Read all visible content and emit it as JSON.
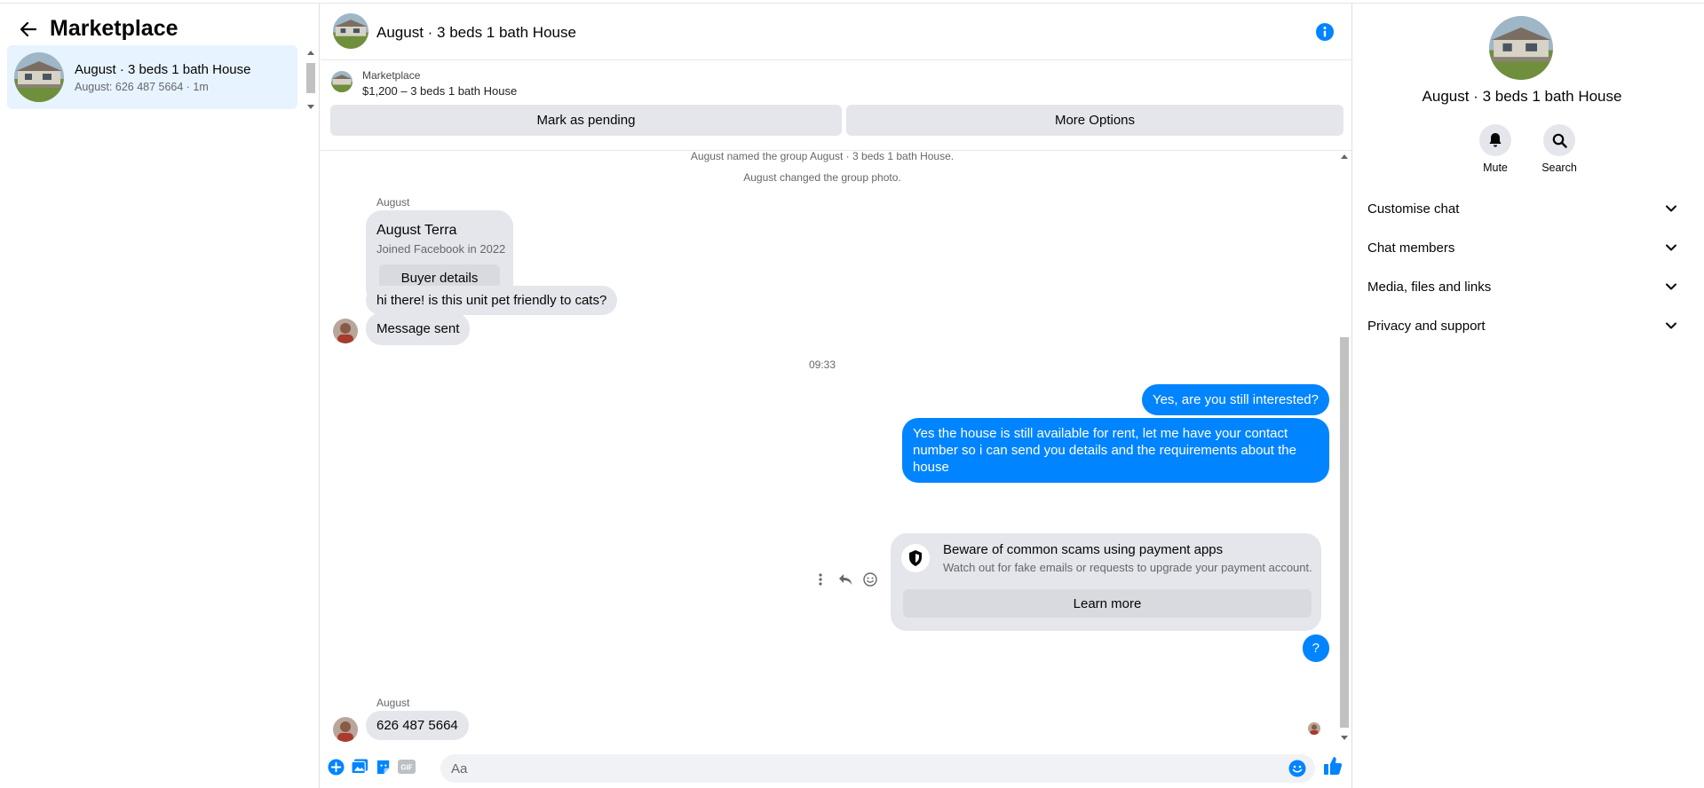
{
  "colors": {
    "accent": "#0084ff",
    "bubble_in": "#e4e6eb",
    "selected": "#e7f3ff"
  },
  "sidebar": {
    "title": "Marketplace",
    "conversations": [
      {
        "title": "August · 3 beds 1 bath House",
        "subtitle": "August: 626 487 5664 · 1m"
      }
    ]
  },
  "chat": {
    "title": "August · 3 beds 1 bath House",
    "listing": {
      "label": "Marketplace",
      "price_title": "$1,200 – 3 beds 1 bath House",
      "mark_pending": "Mark as pending",
      "more_options": "More Options"
    },
    "system_messages": [
      "August named the group August · 3 beds 1 bath House.",
      "August changed the group photo."
    ],
    "buyer_card": {
      "sender": "August",
      "name": "August Terra",
      "subtitle": "Joined Facebook in 2022",
      "button": "Buyer details"
    },
    "incoming_1": "hi there! is this unit pet friendly to cats?",
    "incoming_2": "Message sent",
    "timestamp": "09:33",
    "outgoing_1": "Yes, are you still interested?",
    "outgoing_2": "Yes the house is still available for rent, let me have your contact number so i can send you details and the requirements about the house",
    "scam_warning": {
      "title": "Beware of common scams using payment apps",
      "subtitle": "Watch out for fake emails or requests to upgrade your payment account.",
      "button": "Learn more"
    },
    "outgoing_3": "?",
    "last_sender": "August",
    "incoming_3": "626 487 5664",
    "composer": {
      "placeholder": "Aa"
    }
  },
  "details": {
    "title": "August · 3 beds 1 bath House",
    "actions": [
      {
        "label": "Mute",
        "icon": "bell-icon"
      },
      {
        "label": "Search",
        "icon": "search-icon"
      }
    ],
    "sections": [
      "Customise chat",
      "Chat members",
      "Media, files and links",
      "Privacy and support"
    ]
  }
}
